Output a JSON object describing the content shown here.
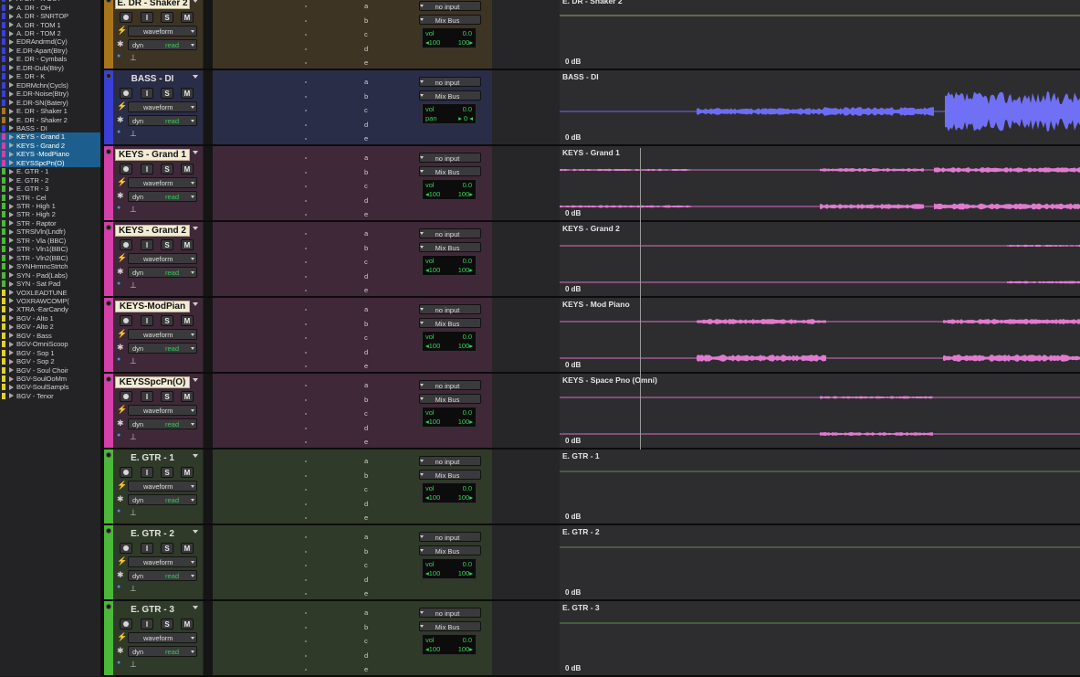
{
  "track_list": [
    {
      "name": "A. DR - K OUT",
      "color": "#3a3fd6",
      "selected": false
    },
    {
      "name": "A. DR - OH",
      "color": "#3a3fd6",
      "selected": false
    },
    {
      "name": "A. DR - SNRTOP",
      "color": "#3a3fd6",
      "selected": false
    },
    {
      "name": "A. DR - TOM 1",
      "color": "#3a3fd6",
      "selected": false
    },
    {
      "name": "A. DR - TOM 2",
      "color": "#3a3fd6",
      "selected": false
    },
    {
      "name": "EDRAndrmd(Cy)",
      "color": "#3a3fd6",
      "selected": false
    },
    {
      "name": "E.DR-Apart(Btry)",
      "color": "#3a3fd6",
      "selected": false
    },
    {
      "name": "E. DR - Cymbals",
      "color": "#3a3fd6",
      "selected": false
    },
    {
      "name": "E.DR-Dub(Btry)",
      "color": "#3a3fd6",
      "selected": false
    },
    {
      "name": "E. DR - K",
      "color": "#3a3fd6",
      "selected": false
    },
    {
      "name": "EDRMchn(Cycls)",
      "color": "#3a3fd6",
      "selected": false
    },
    {
      "name": "E.DR-Noise(Btry)",
      "color": "#3a3fd6",
      "selected": false
    },
    {
      "name": "E.DR-SN(Batery)",
      "color": "#3a3fd6",
      "selected": false
    },
    {
      "name": "E. DR - Shaker 1",
      "color": "#a8741c",
      "selected": false
    },
    {
      "name": "E. DR - Shaker 2",
      "color": "#a8741c",
      "selected": false
    },
    {
      "name": "BASS - DI",
      "color": "#3a3fd6",
      "selected": false
    },
    {
      "name": "KEYS - Grand 1",
      "color": "#d43fa8",
      "selected": true
    },
    {
      "name": "KEYS - Grand 2",
      "color": "#d43fa8",
      "selected": true
    },
    {
      "name": "KEYS -ModPiano",
      "color": "#d43fa8",
      "selected": true
    },
    {
      "name": "KEYSSpcPn(O)",
      "color": "#d43fa8",
      "selected": true
    },
    {
      "name": "E. GTR - 1",
      "color": "#4cb83a",
      "selected": false
    },
    {
      "name": "E. GTR - 2",
      "color": "#4cb83a",
      "selected": false
    },
    {
      "name": "E. GTR - 3",
      "color": "#4cb83a",
      "selected": false
    },
    {
      "name": "STR - Cel",
      "color": "#4cb83a",
      "selected": false
    },
    {
      "name": "STR - High 1",
      "color": "#4cb83a",
      "selected": false
    },
    {
      "name": "STR - High 2",
      "color": "#4cb83a",
      "selected": false
    },
    {
      "name": "STR - Raptor",
      "color": "#4cb83a",
      "selected": false
    },
    {
      "name": "STRSlVln(Lndfr)",
      "color": "#4cb83a",
      "selected": false
    },
    {
      "name": "STR - Vla (BBC)",
      "color": "#4cb83a",
      "selected": false
    },
    {
      "name": "STR - Vln1(BBC)",
      "color": "#4cb83a",
      "selected": false
    },
    {
      "name": "STR - Vln2(BBC)",
      "color": "#4cb83a",
      "selected": false
    },
    {
      "name": "SYNHrmncStrtch",
      "color": "#4cb83a",
      "selected": false
    },
    {
      "name": "SYN - Pad(Labs)",
      "color": "#4cb83a",
      "selected": false
    },
    {
      "name": "SYN - Sat Pad",
      "color": "#4cb83a",
      "selected": false
    },
    {
      "name": "VOXLEADTUNE",
      "color": "#e0d22a",
      "selected": false
    },
    {
      "name": "VOXRAWCOMP(",
      "color": "#e0d22a",
      "selected": false
    },
    {
      "name": "XTRA -EarCandy",
      "color": "#e0d22a",
      "selected": false
    },
    {
      "name": "BGV - Alto 1",
      "color": "#e0d22a",
      "selected": false
    },
    {
      "name": "BGV - Alto 2",
      "color": "#e0d22a",
      "selected": false
    },
    {
      "name": "BGV - Bass",
      "color": "#e0d22a",
      "selected": false
    },
    {
      "name": "BGV-OmniScoop",
      "color": "#e0d22a",
      "selected": false
    },
    {
      "name": "BGV - Sop 1",
      "color": "#e0d22a",
      "selected": false
    },
    {
      "name": "BGV - Sop 2",
      "color": "#e0d22a",
      "selected": false
    },
    {
      "name": "BGV - Soul Choir",
      "color": "#e0d22a",
      "selected": false
    },
    {
      "name": "BGV-SoulOoMm",
      "color": "#e0d22a",
      "selected": false
    },
    {
      "name": "BGV-SoulSampls",
      "color": "#e0d22a",
      "selected": false
    },
    {
      "name": "BGV - Tenor",
      "color": "#e0d22a",
      "selected": false
    }
  ],
  "edit_tracks": [
    {
      "name": "E. DR - Shaker 2",
      "clip_name": "E. DR - Shaker 2",
      "color": "#a8741c",
      "bg": "#3e3424",
      "lane_line": "#a89a5e",
      "highlight": true,
      "input": "no input",
      "output": "Mix Bus",
      "view": "waveform",
      "auto": "dyn",
      "auto_mode": "read",
      "vol_label": "vol",
      "vol": "0.0",
      "pan_l": "◂100",
      "pan_r": "100▸",
      "db": "0 dB",
      "wave": "none"
    },
    {
      "name": "BASS - DI",
      "clip_name": "BASS - DI",
      "color": "#3a3fd6",
      "bg": "#2a2d48",
      "lane_line": "#6a6df0",
      "highlight": false,
      "input": "no input",
      "output": "Mix Bus",
      "view": "waveform",
      "auto": "dyn",
      "auto_mode": "read",
      "vol_label": "vol",
      "vol": "0.0",
      "pan_l": "pan",
      "pan_r": "▸ 0 ◂",
      "db": "0 dB",
      "wave": "bass"
    },
    {
      "name": "KEYS - Grand 1",
      "clip_name": "KEYS - Grand 1",
      "color": "#d43fa8",
      "bg": "#3f2838",
      "lane_line": "#d86ec6",
      "highlight": true,
      "input": "no input",
      "output": "Mix Bus",
      "view": "waveform",
      "auto": "dyn",
      "auto_mode": "read",
      "vol_label": "vol",
      "vol": "0.0",
      "pan_l": "◂100",
      "pan_r": "100▸",
      "db": "0 dB",
      "wave": "grand1"
    },
    {
      "name": "KEYS - Grand 2",
      "clip_name": "KEYS - Grand 2",
      "color": "#d43fa8",
      "bg": "#3f2838",
      "lane_line": "#d86ec6",
      "highlight": true,
      "input": "no input",
      "output": "Mix Bus",
      "view": "waveform",
      "auto": "dyn",
      "auto_mode": "read",
      "vol_label": "vol",
      "vol": "0.0",
      "pan_l": "◂100",
      "pan_r": "100▸",
      "db": "0 dB",
      "wave": "grand2"
    },
    {
      "name": "KEYS-ModPian",
      "clip_name": "KEYS - Mod Piano",
      "color": "#d43fa8",
      "bg": "#3f2838",
      "lane_line": "#d86ec6",
      "highlight": true,
      "input": "no input",
      "output": "Mix Bus",
      "view": "waveform",
      "auto": "dyn",
      "auto_mode": "read",
      "vol_label": "vol",
      "vol": "0.0",
      "pan_l": "◂100",
      "pan_r": "100▸",
      "db": "0 dB",
      "wave": "modpiano"
    },
    {
      "name": "KEYSSpcPn(O)",
      "clip_name": "KEYS - Space Pno (Omni)",
      "color": "#d43fa8",
      "bg": "#3f2838",
      "lane_line": "#d86ec6",
      "highlight": true,
      "input": "no input",
      "output": "Mix Bus",
      "view": "waveform",
      "auto": "dyn",
      "auto_mode": "read",
      "vol_label": "vol",
      "vol": "0.0",
      "pan_l": "◂100",
      "pan_r": "100▸",
      "db": "0 dB",
      "wave": "space"
    },
    {
      "name": "E. GTR - 1",
      "clip_name": "E. GTR - 1",
      "color": "#4cb83a",
      "bg": "#2f3a28",
      "lane_line": "#5f8a4e",
      "highlight": false,
      "input": "no input",
      "output": "Mix Bus",
      "view": "waveform",
      "auto": "dyn",
      "auto_mode": "read",
      "vol_label": "vol",
      "vol": "0.0",
      "pan_l": "◂100",
      "pan_r": "100▸",
      "db": "0 dB",
      "wave": "none"
    },
    {
      "name": "E. GTR - 2",
      "clip_name": "E. GTR - 2",
      "color": "#4cb83a",
      "bg": "#2f3a28",
      "lane_line": "#5f8a4e",
      "highlight": false,
      "input": "no input",
      "output": "Mix Bus",
      "view": "waveform",
      "auto": "dyn",
      "auto_mode": "read",
      "vol_label": "vol",
      "vol": "0.0",
      "pan_l": "◂100",
      "pan_r": "100▸",
      "db": "0 dB",
      "wave": "none"
    },
    {
      "name": "E. GTR - 3",
      "clip_name": "E. GTR - 3",
      "color": "#4cb83a",
      "bg": "#2f3a28",
      "lane_line": "#5f8a4e",
      "highlight": false,
      "input": "no input",
      "output": "Mix Bus",
      "view": "waveform",
      "auto": "dyn",
      "auto_mode": "read",
      "vol_label": "vol",
      "vol": "0.0",
      "pan_l": "◂100",
      "pan_r": "100▸",
      "db": "0 dB",
      "wave": "none"
    }
  ],
  "buttons": {
    "input_monitor": "I",
    "solo": "S",
    "mute": "M"
  },
  "sends": [
    "a",
    "b",
    "c",
    "d",
    "e"
  ]
}
